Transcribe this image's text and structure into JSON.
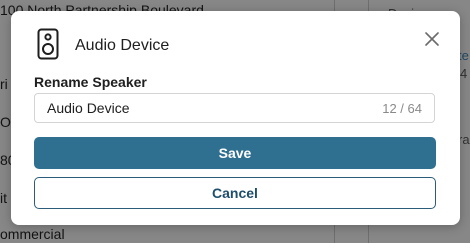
{
  "background": {
    "top_text": "100 North Partnership Boulevard",
    "bottom_text": "ommercial",
    "left_fragments": [
      "ri",
      "O",
      "80",
      "it"
    ],
    "right_fragments": [
      "Devi",
      "te",
      "4",
      "ra"
    ]
  },
  "dialog": {
    "icon": "speaker-icon",
    "title": "Audio Device",
    "close_icon": "close-icon",
    "field_label": "Rename Speaker",
    "input_value": "Audio Device",
    "char_counter": "12 / 64",
    "save_label": "Save",
    "cancel_label": "Cancel"
  },
  "colors": {
    "primary": "#2f7090",
    "cancel_text": "#1f4e6b",
    "overlay": "rgba(0,0,0,0.42)"
  }
}
